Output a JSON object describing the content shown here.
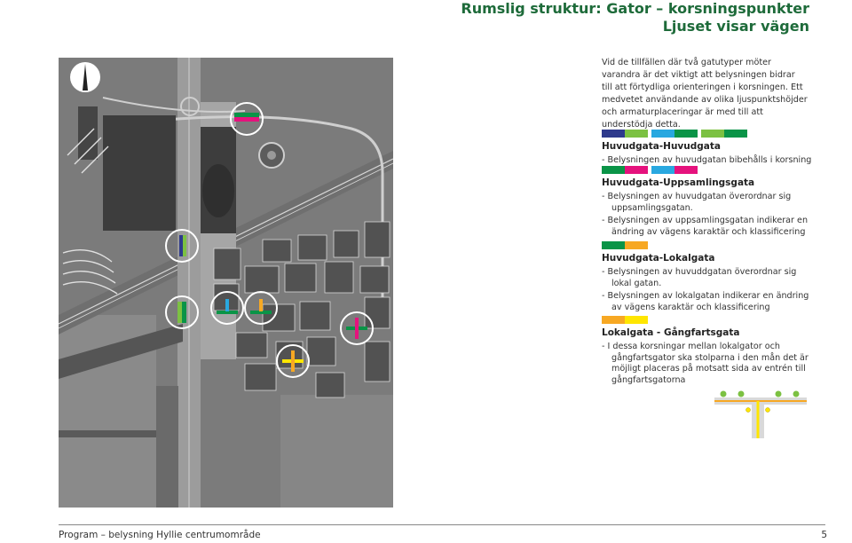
{
  "header": {
    "line1": "Rumslig struktur: Gator – korsningspunkter",
    "line2": "Ljuset visar vägen"
  },
  "intro": "Vid de tillfällen där två gatutyper möter varandra är det viktigt att belysningen bidrar till att förtydliga orienteringen i korsningen. Ett medvetet användande av olika ljuspunktshöjder och armaturplaceringar är med till att understödja detta.",
  "colors": {
    "navy": "#2e3a8c",
    "light_green": "#7cc142",
    "cyan": "#29a8e0",
    "dark_green": "#0a9447",
    "magenta": "#e5127d",
    "orange": "#f7a823",
    "yellow": "#ffe600",
    "title_green": "#1e6b3a"
  },
  "sections": [
    {
      "title": "Huvudgata-Huvudgata",
      "swatch_pairs": [
        [
          "navy",
          "light_green"
        ],
        [
          "cyan",
          "dark_green"
        ],
        [
          "light_green",
          "dark_green"
        ]
      ],
      "bullets": [
        "Belysningen av huvudgatan bibehålls i korsning"
      ]
    },
    {
      "title": "Huvudgata-Uppsamlingsgata",
      "swatch_pairs": [
        [
          "dark_green",
          "magenta"
        ],
        [
          "cyan",
          "magenta"
        ]
      ],
      "bullets": [
        "Belysningen av huvudgatan överordnar sig uppsamlingsgatan.",
        "Belysningen av uppsamlingsgatan indikerar en ändring av vägens karaktär och klassificering"
      ]
    },
    {
      "title": "Huvudgata-Lokalgata",
      "swatch_pairs": [
        [
          "dark_green",
          "orange"
        ]
      ],
      "bullets": [
        "Belysningen av huvuddgatan överordnar sig lokal gatan.",
        "Belysningen av lokalgatan indikerar en ändring av vägens karaktär och klassificering"
      ]
    },
    {
      "title": "Lokalgata - Gångfartsgata",
      "swatch_pairs": [
        [
          "orange",
          "yellow"
        ]
      ],
      "bullets": [
        "I dessa korsningar mellan lokalgator och gångfartsgator ska stolparna i den mån det är möjligt placeras på motsatt sida av entrén till gångfartsgatorna"
      ]
    }
  ],
  "footer": {
    "left": "Program – belysning Hyllie centrumområde",
    "page": "5"
  }
}
